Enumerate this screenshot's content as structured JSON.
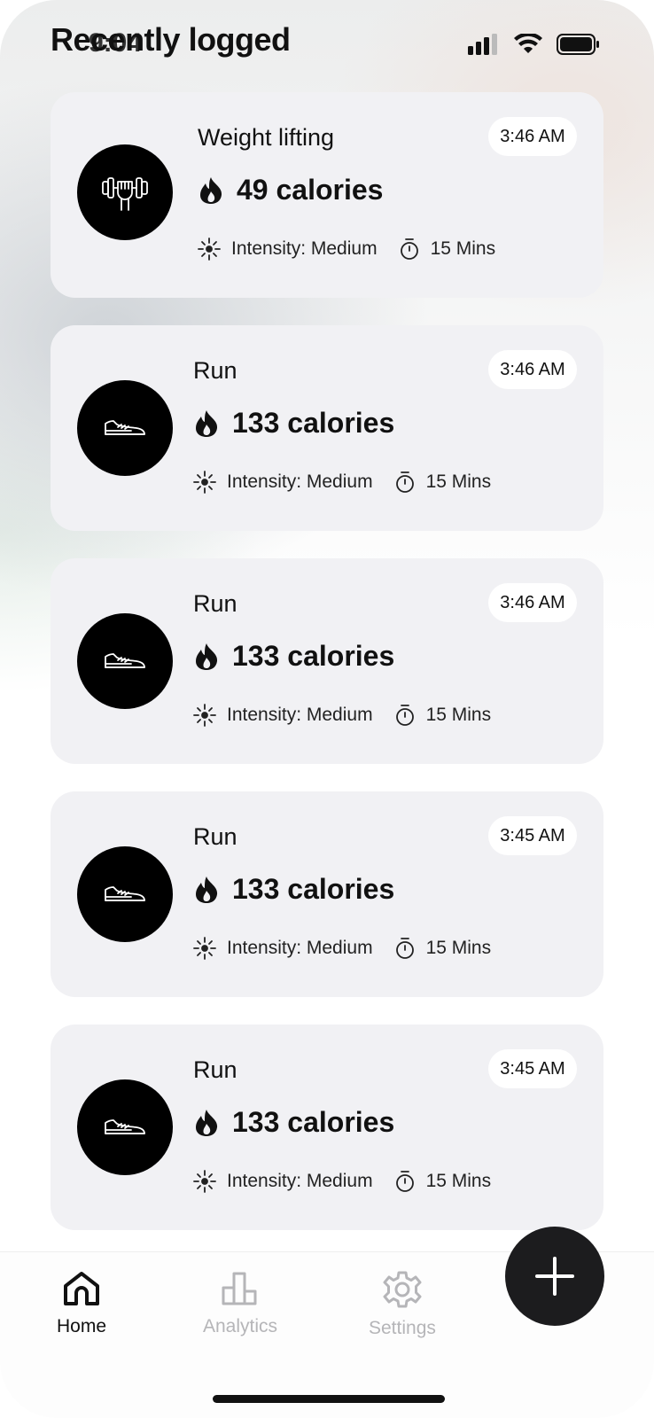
{
  "status_bar": {
    "time": "9:04"
  },
  "page": {
    "title": "Recently logged"
  },
  "entries": [
    {
      "activity": "Weight lifting",
      "time": "3:46 AM",
      "calories": "49 calories",
      "intensity": "Intensity: Medium",
      "duration": "15 Mins",
      "icon": "dumbbell-icon"
    },
    {
      "activity": "Run",
      "time": "3:46 AM",
      "calories": "133 calories",
      "intensity": "Intensity: Medium",
      "duration": "15 Mins",
      "icon": "shoe-icon"
    },
    {
      "activity": "Run",
      "time": "3:46 AM",
      "calories": "133 calories",
      "intensity": "Intensity: Medium",
      "duration": "15 Mins",
      "icon": "shoe-icon"
    },
    {
      "activity": "Run",
      "time": "3:45 AM",
      "calories": "133 calories",
      "intensity": "Intensity: Medium",
      "duration": "15 Mins",
      "icon": "shoe-icon"
    },
    {
      "activity": "Run",
      "time": "3:45 AM",
      "calories": "133 calories",
      "intensity": "Intensity: Medium",
      "duration": "15 Mins",
      "icon": "shoe-icon"
    }
  ],
  "nav": {
    "home": "Home",
    "analytics": "Analytics",
    "settings": "Settings",
    "active": "home"
  },
  "colors": {
    "active": "#111111",
    "inactive": "#b5b5b8",
    "card": "#f1f1f4",
    "fab": "#1c1c1e"
  }
}
